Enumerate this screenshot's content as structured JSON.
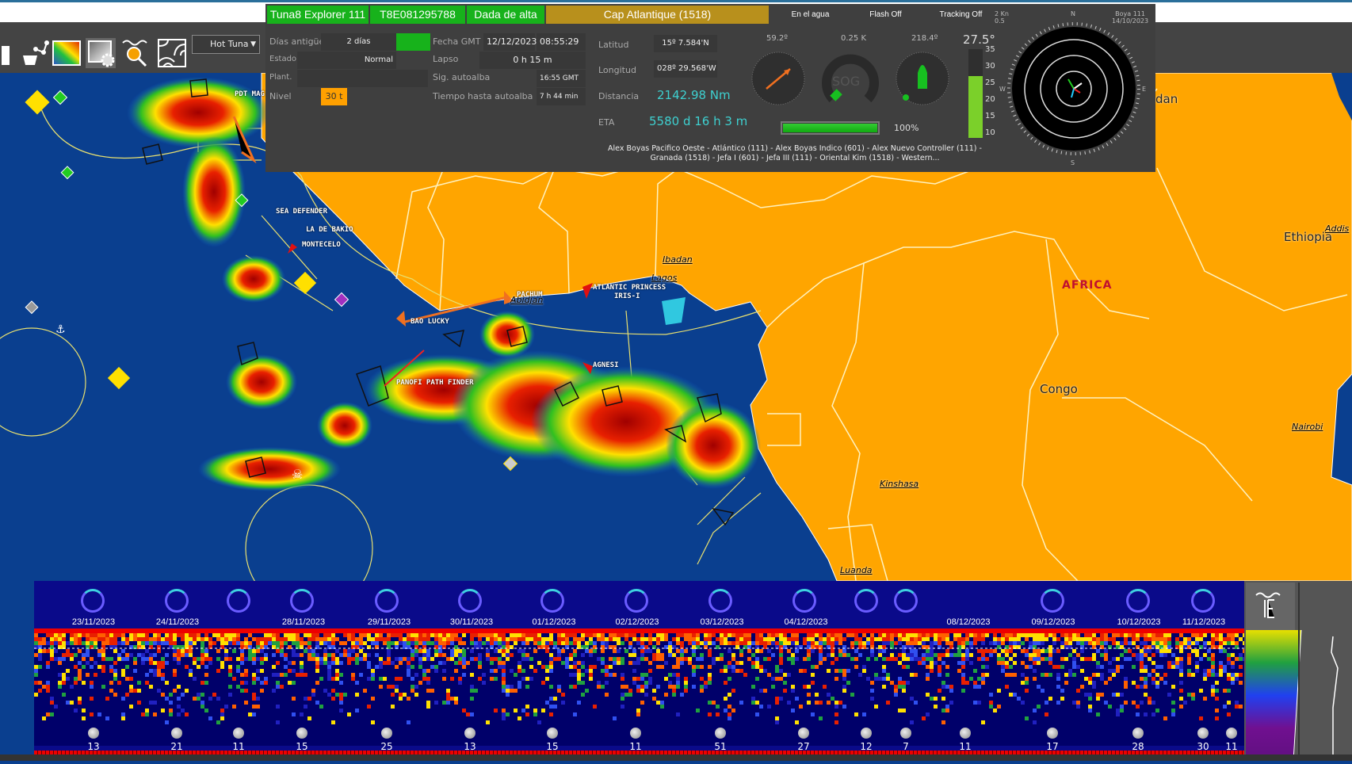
{
  "toolbar": {
    "icons": [
      "basket-route-icon",
      "color-gradient-icon",
      "gradient-settings-icon",
      "sea-search-icon",
      "contour-icon"
    ],
    "layer_select": "Hot Tuna"
  },
  "panel": {
    "vessel": "Tuna8 Explorer 111",
    "id": "T8E081295788",
    "status": "Dada de alta",
    "buoy_owner": "Cap Atlantique (1518)",
    "in_water": "En el agua",
    "flash": "Flash Off",
    "tracking": "Tracking Off",
    "rows": {
      "dias_label": "Días antigüedad",
      "dias_value": "2 días",
      "estado_label": "Estado",
      "estado_value": "Normal",
      "plant_label": "Plant.",
      "plant_value": "",
      "nivel_label": "Nivel",
      "nivel_value": "30 t",
      "fecha_label": "Fecha GMT",
      "fecha_date": "12/12/2023",
      "fecha_time": "08:55:29",
      "lapso_label": "Lapso",
      "lapso_value": "0 h 15 m",
      "sig_label": "Sig. autoalba",
      "sig_value": "16:55 GMT",
      "tiempo_label": "Tiempo hasta autoalba",
      "tiempo_value": "7 h 44 min"
    },
    "position": {
      "lat_label": "Latitud",
      "lat": "15º 7.584'N",
      "lon_label": "Longitud",
      "lon": "028º 29.568'W",
      "dist_label": "Distancia",
      "dist": "2142.98 Nm",
      "eta_label": "ETA",
      "eta": "5580 d 16 h 3 m"
    },
    "vessels": "Alex Boyas Pacifico Oeste - Atlántico (111) - Alex Boyas Indico (601) - Alex Nuevo Controller (111) - Granada (1518) - Jefa I (601) - Jefa III (111) - Oriental Kim (1518) - Western...",
    "heading": "59.2º",
    "sog_speed": "0.25 K",
    "sog_label": "SOG",
    "drift_heading": "218.4º",
    "temperature": "27.5°",
    "temp_scale": [
      "35",
      "30",
      "25",
      "20",
      "15",
      "10"
    ],
    "temp_level": 27.5,
    "battery": "100%",
    "battery_level": 100,
    "current_scale": "2 Kn",
    "current_scale2": "0.5",
    "buoy": "Boya 111",
    "buoy_date": "14/10/2023",
    "compass": {
      "n": "N",
      "s": "S",
      "e": "E",
      "w": "W"
    }
  },
  "map": {
    "vessel_labels": [
      "PDT MAG",
      "SEA DEFENDER",
      "LA DE BAKIO",
      "MONTECELO",
      "BAO LUCKY",
      "PANOFI PATH FINDER",
      "ATLANTIC PRINCESS",
      "IRIS-I",
      "AGNESI",
      "PACHUM"
    ],
    "cities": [
      "Ibadan",
      "Lagos",
      "Abidjan",
      "Kinshasa",
      "Luanda",
      "Nairobi",
      "Addis"
    ],
    "countries": [
      "Ethiopia",
      "Congo",
      "dan"
    ],
    "continent": "AFRICA",
    "colors": {
      "land": "#ffa500",
      "sea": "#0a3f8f",
      "accent": "#17b21b"
    }
  },
  "timeline": {
    "dates": [
      "23/11/2023",
      "24/11/2023",
      "28/11/2023",
      "29/11/2023",
      "30/11/2023",
      "01/12/2023",
      "02/12/2023",
      "03/12/2023",
      "04/12/2023",
      "08/12/2023",
      "09/12/2023",
      "10/12/2023",
      "11/12/2023"
    ],
    "moon_values": [
      "13",
      "21",
      "11",
      "15",
      "25",
      "13",
      "15",
      "11",
      "51",
      "27",
      "12",
      "7",
      "11",
      "17",
      "28",
      "30",
      "11"
    ]
  }
}
